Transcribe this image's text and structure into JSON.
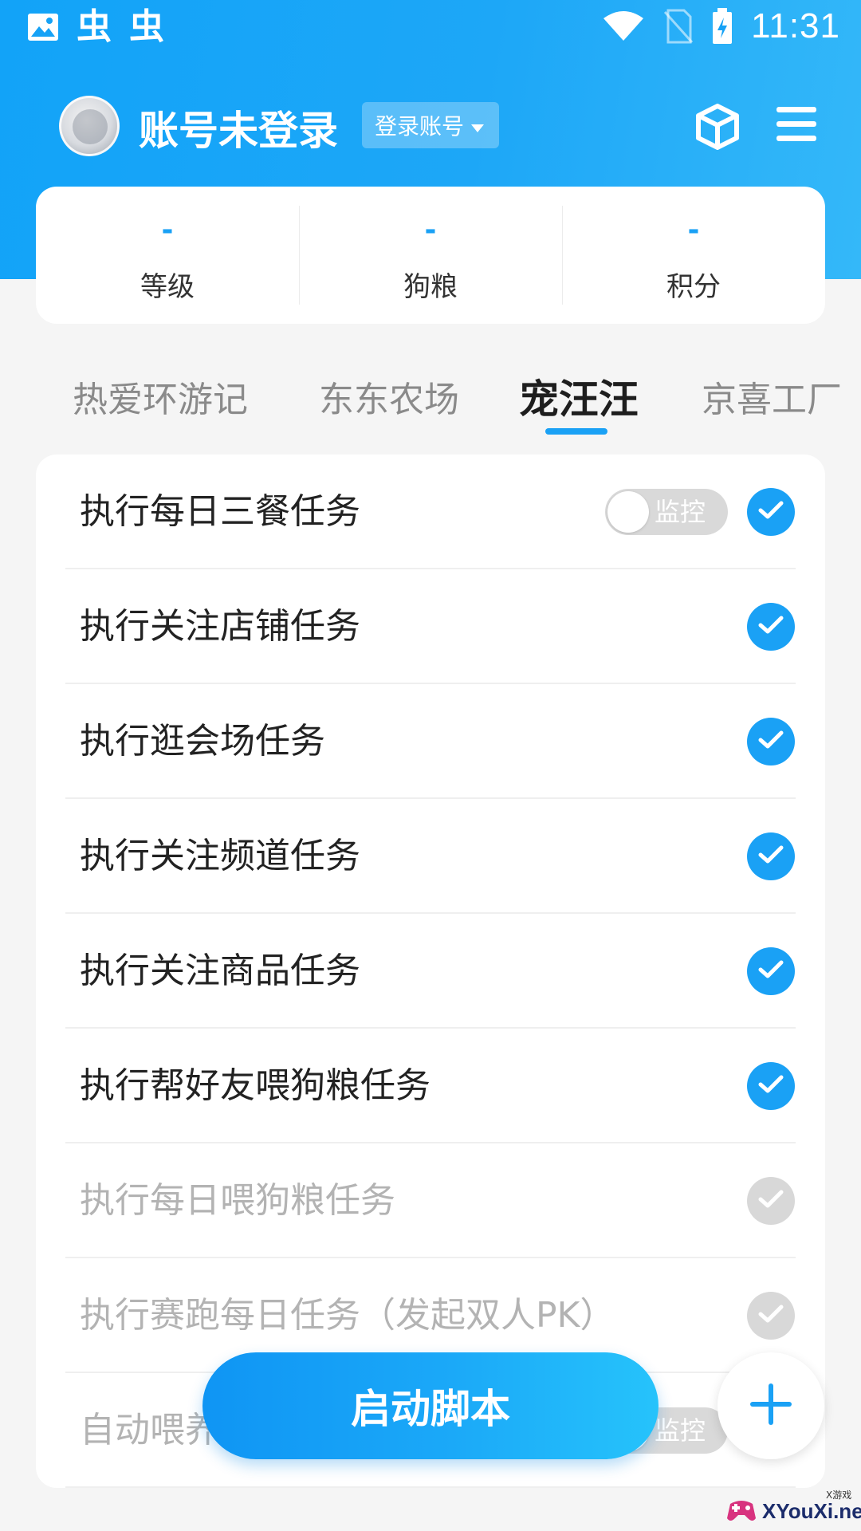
{
  "status_bar": {
    "time": "11:31",
    "app_icons": [
      "gallery-icon",
      "chongchong-icon",
      "chongchong-icon"
    ],
    "app_glyph": "虫"
  },
  "header": {
    "title": "账号未登录",
    "login_button": "登录账号"
  },
  "stats": [
    {
      "value": "-",
      "label": "等级"
    },
    {
      "value": "-",
      "label": "狗粮"
    },
    {
      "value": "-",
      "label": "积分"
    }
  ],
  "tabs": [
    {
      "label": "热爱环游记",
      "active": false
    },
    {
      "label": "东东农场",
      "active": false
    },
    {
      "label": "宠汪汪",
      "active": true
    },
    {
      "label": "京喜工厂",
      "active": false
    }
  ],
  "tasks": [
    {
      "label": "执行每日三餐任务",
      "checked": true,
      "monitor": "监控"
    },
    {
      "label": "执行关注店铺任务",
      "checked": true
    },
    {
      "label": "执行逛会场任务",
      "checked": true
    },
    {
      "label": "执行关注频道任务",
      "checked": true
    },
    {
      "label": "执行关注商品任务",
      "checked": true
    },
    {
      "label": "执行帮好友喂狗粮任务",
      "checked": true
    },
    {
      "label": "执行每日喂狗粮任务",
      "checked": false
    },
    {
      "label": "执行赛跑每日任务（发起双人PK）",
      "checked": false
    },
    {
      "label": "自动喂养",
      "checked": false,
      "monitor": "监控"
    }
  ],
  "start_button": "启动脚本",
  "watermark": {
    "text": "XYouXi.net",
    "small": "X游戏"
  },
  "colors": {
    "accent": "#1aa1f5",
    "disabled": "#d8d8d8",
    "header": "#12a3f8"
  }
}
